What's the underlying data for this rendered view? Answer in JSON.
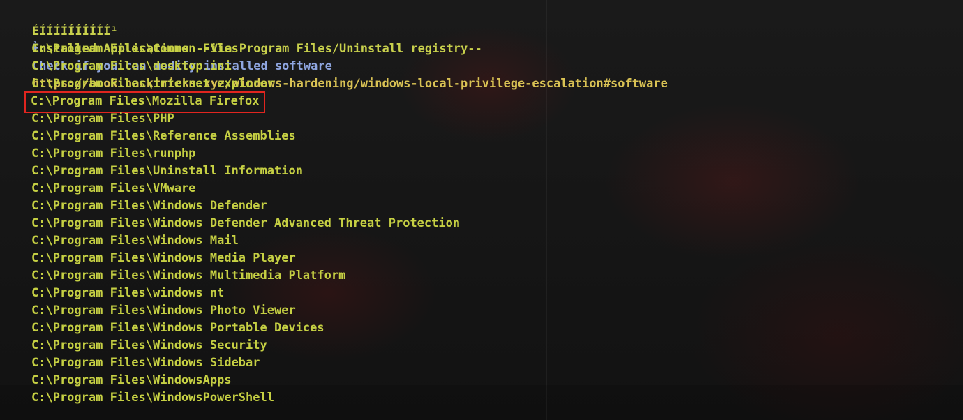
{
  "header": {
    "marker": "ÉÍÍÍÍÍÍÍÍÍÍ¹",
    "title": "Installed Applications --Via Program Files/Uninstall registry--"
  },
  "info": {
    "marker": "È",
    "text": "Check if you can modify installed software",
    "url": "https://book.hacktricks.xyz/windows-hardening/windows-local-privilege-escalation#software"
  },
  "paths": [
    "C:\\Program Files\\Common Files",
    "C:\\Program Files\\desktop.ini",
    "C:\\Program Files\\internet explorer",
    "C:\\Program Files\\Mozilla Firefox",
    "C:\\Program Files\\PHP",
    "C:\\Program Files\\Reference Assemblies",
    "C:\\Program Files\\runphp",
    "C:\\Program Files\\Uninstall Information",
    "C:\\Program Files\\VMware",
    "C:\\Program Files\\Windows Defender",
    "C:\\Program Files\\Windows Defender Advanced Threat Protection",
    "C:\\Program Files\\Windows Mail",
    "C:\\Program Files\\Windows Media Player",
    "C:\\Program Files\\Windows Multimedia Platform",
    "C:\\Program Files\\windows nt",
    "C:\\Program Files\\Windows Photo Viewer",
    "C:\\Program Files\\Windows Portable Devices",
    "C:\\Program Files\\Windows Security",
    "C:\\Program Files\\Windows Sidebar",
    "C:\\Program Files\\WindowsApps",
    "C:\\Program Files\\WindowsPowerShell"
  ],
  "colors": {
    "header": "#c8d04c",
    "info": "#8fa6e0",
    "url": "#d9c254",
    "path": "#c6d043",
    "highlight_box": "#e0251f"
  }
}
